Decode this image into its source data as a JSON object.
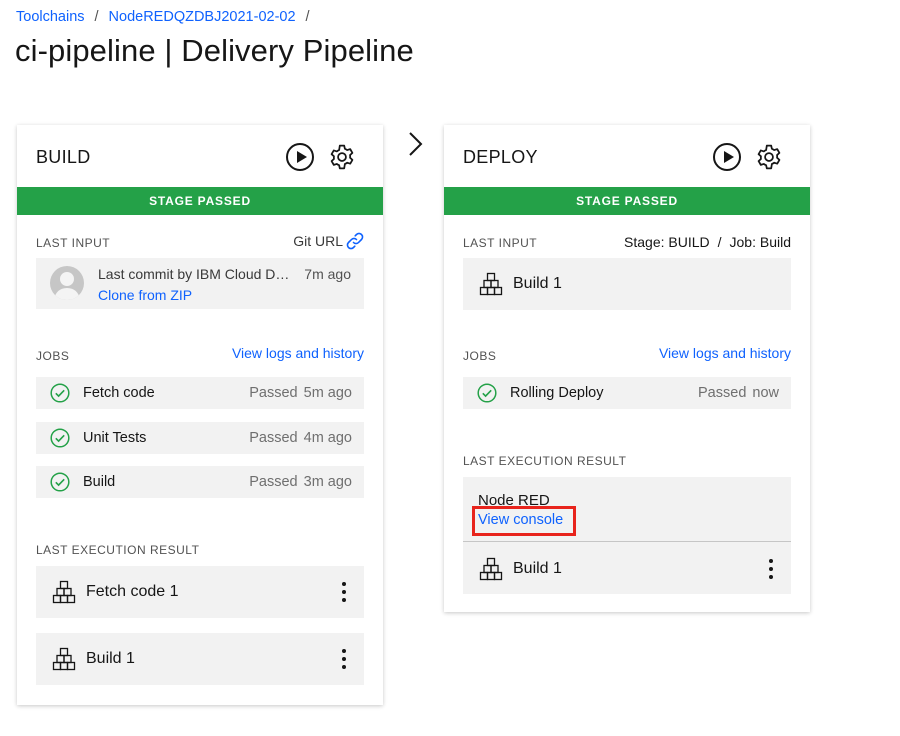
{
  "breadcrumb": {
    "items": [
      "Toolchains",
      "NodeREDQZDBJ2021-02-02"
    ],
    "separator": "/"
  },
  "page_title": "ci-pipeline | Delivery Pipeline",
  "colors": {
    "passed": "#24a148",
    "link": "#0f62fe",
    "highlight": "#e8241c"
  },
  "stages": {
    "build": {
      "name": "BUILD",
      "status": "STAGE PASSED",
      "last_input_label": "LAST INPUT",
      "input_type": "Git URL",
      "commit": {
        "message": "Last commit by IBM Cloud DevOps",
        "time": "7m ago",
        "link": "Clone from ZIP"
      },
      "jobs_label": "JOBS",
      "view_logs": "View logs and history",
      "jobs": [
        {
          "name": "Fetch code",
          "status": "Passed",
          "time": "5m ago"
        },
        {
          "name": "Unit Tests",
          "status": "Passed",
          "time": "4m ago"
        },
        {
          "name": "Build",
          "status": "Passed",
          "time": "3m ago"
        }
      ],
      "last_result_label": "LAST EXECUTION RESULT",
      "results": [
        "Fetch code 1",
        "Build 1"
      ]
    },
    "deploy": {
      "name": "DEPLOY",
      "status": "STAGE PASSED",
      "last_input_label": "LAST INPUT",
      "input_stage": "Stage: BUILD",
      "input_separator": "/",
      "input_job": "Job: Build",
      "input_build": "Build 1",
      "jobs_label": "JOBS",
      "view_logs": "View logs and history",
      "jobs": [
        {
          "name": "Rolling Deploy",
          "status": "Passed",
          "time": "now"
        }
      ],
      "last_result_label": "LAST EXECUTION RESULT",
      "app_name": "Node RED",
      "view_console": "View console",
      "result_build": "Build 1"
    }
  },
  "icons": {
    "run": "play-icon",
    "settings": "gear-icon",
    "link": "link-icon",
    "job_status": "checkmark-circle-icon",
    "build": "blocks-icon",
    "more": "overflow-menu-icon",
    "stage_arrow": "chevron-right-icon"
  }
}
